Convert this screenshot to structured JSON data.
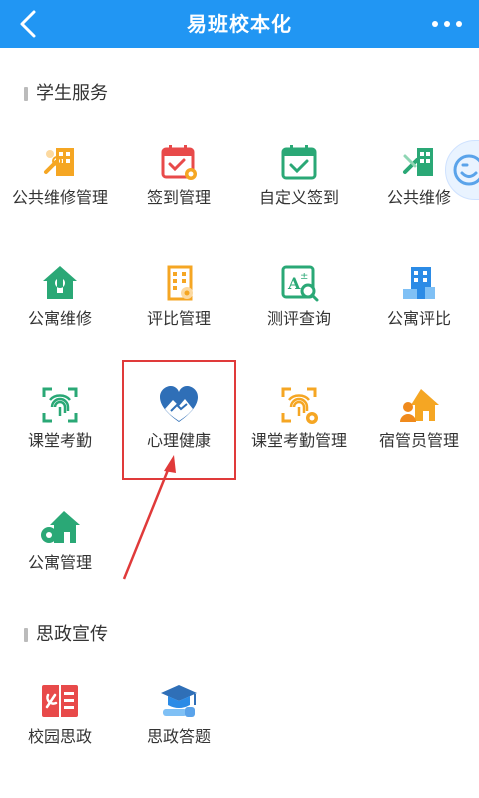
{
  "header": {
    "title": "易班校本化"
  },
  "sections": [
    {
      "title": "学生服务",
      "items": [
        {
          "label": "公共维修管理",
          "icon": "maintenance-management-icon"
        },
        {
          "label": "签到管理",
          "icon": "calendar-gear-icon"
        },
        {
          "label": "自定义签到",
          "icon": "calendar-check-icon"
        },
        {
          "label": "公共维修",
          "icon": "building-tools-icon"
        },
        {
          "label": "公寓维修",
          "icon": "house-wrench-icon"
        },
        {
          "label": "评比管理",
          "icon": "building-evaluation-icon"
        },
        {
          "label": "测评查询",
          "icon": "assessment-search-icon"
        },
        {
          "label": "公寓评比",
          "icon": "apartment-rating-icon"
        },
        {
          "label": "课堂考勤",
          "icon": "fingerprint-scan-icon"
        },
        {
          "label": "心理健康",
          "icon": "heart-landscape-icon"
        },
        {
          "label": "课堂考勤管理",
          "icon": "fingerprint-gear-icon"
        },
        {
          "label": "宿管员管理",
          "icon": "dorm-manager-icon"
        },
        {
          "label": "公寓管理",
          "icon": "apartment-gear-icon"
        }
      ]
    },
    {
      "title": "思政宣传",
      "items": [
        {
          "label": "校园思政",
          "icon": "party-book-icon"
        },
        {
          "label": "思政答题",
          "icon": "graduation-cap-icon"
        }
      ]
    }
  ],
  "colors": {
    "header_bg": "#2196f3",
    "orange": "#f5a623",
    "red": "#e84a4a",
    "teal": "#2aa876",
    "blue": "#2b8be6"
  }
}
